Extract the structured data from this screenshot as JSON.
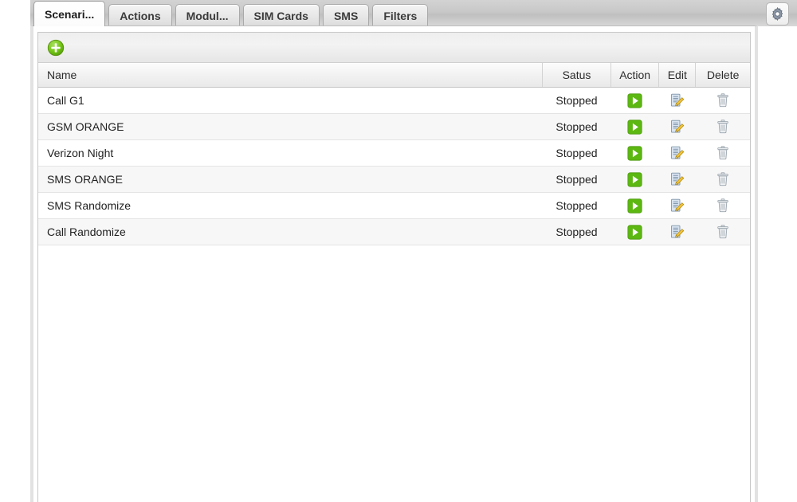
{
  "tabs": [
    {
      "label": "Scenari...",
      "active": true,
      "name": "tab-scenarios"
    },
    {
      "label": "Actions",
      "active": false,
      "name": "tab-actions"
    },
    {
      "label": "Modul...",
      "active": false,
      "name": "tab-modules"
    },
    {
      "label": "SIM Cards",
      "active": false,
      "name": "tab-sim-cards"
    },
    {
      "label": "SMS",
      "active": false,
      "name": "tab-sms"
    },
    {
      "label": "Filters",
      "active": false,
      "name": "tab-filters"
    }
  ],
  "toolbar": {
    "add_icon": "add-circle-icon",
    "settings_icon": "gear-icon"
  },
  "table": {
    "columns": [
      {
        "key": "name",
        "label": "Name"
      },
      {
        "key": "status",
        "label": "Satus"
      },
      {
        "key": "action",
        "label": "Action"
      },
      {
        "key": "edit",
        "label": "Edit"
      },
      {
        "key": "delete",
        "label": "Delete"
      }
    ],
    "rows": [
      {
        "name": "Call G1",
        "status": "Stopped"
      },
      {
        "name": "GSM ORANGE",
        "status": "Stopped"
      },
      {
        "name": "Verizon Night",
        "status": "Stopped"
      },
      {
        "name": "SMS ORANGE",
        "status": "Stopped"
      },
      {
        "name": "SMS Randomize",
        "status": "Stopped"
      },
      {
        "name": "Call Randomize",
        "status": "Stopped"
      }
    ],
    "row_icons": {
      "action": "play-icon",
      "edit": "edit-document-pencil-icon",
      "delete": "trash-can-icon"
    }
  },
  "colors": {
    "accent_green": "#5cb811",
    "tabstrip_gray": "#c8c8c8",
    "panel_border": "#e2e2e2",
    "header_text": "#2b2b2b"
  }
}
